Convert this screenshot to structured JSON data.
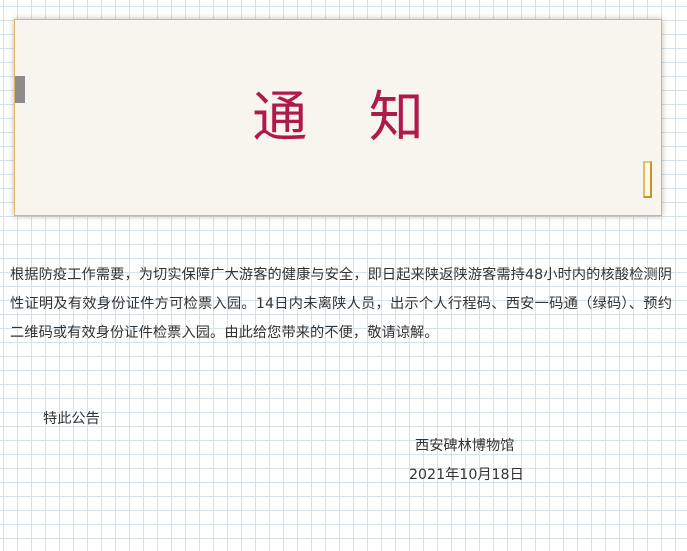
{
  "notice": {
    "title": "通 知",
    "body": "根据防疫工作需要，为切实保障广大游客的健康与安全，即日起来陕返陕游客需持48小时内的核酸检测阴性证明及有效身份证件方可检票入园。14日内未离陕人员，出示个人行程码、西安一码通（绿码）、预约二维码或有效身份证件检票入园。由此给您带来的不便，敬请谅解。",
    "special_note": "特此公告",
    "organization": "西安碑林博物馆",
    "date": "2021年10月18日"
  },
  "colors": {
    "title": "#b01a4b",
    "card_background": "#f8f5ee",
    "card_border": "#d8b56a",
    "grid_line": "#d6e1ea",
    "text": "#333333"
  }
}
